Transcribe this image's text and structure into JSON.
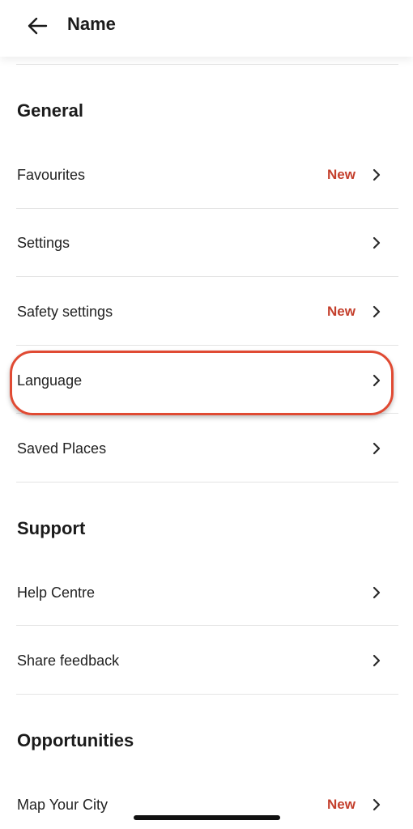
{
  "header": {
    "title": "Name",
    "back_icon": "arrow-left-icon"
  },
  "sections": {
    "general": {
      "title": "General",
      "items": [
        {
          "label": "Favourites",
          "badge": "New"
        },
        {
          "label": "Settings",
          "badge": ""
        },
        {
          "label": "Safety settings",
          "badge": "New"
        },
        {
          "label": "Language",
          "badge": "",
          "highlighted": true
        },
        {
          "label": "Saved Places",
          "badge": ""
        }
      ]
    },
    "support": {
      "title": "Support",
      "items": [
        {
          "label": "Help Centre",
          "badge": ""
        },
        {
          "label": "Share feedback",
          "badge": ""
        }
      ]
    },
    "opportunities": {
      "title": "Opportunities",
      "items": [
        {
          "label": "Map Your City",
          "badge": "New"
        }
      ]
    }
  },
  "colors": {
    "badge": "#c43f2c",
    "highlight_outline": "#e04a33",
    "divider": "#e4e4e4",
    "text": "#1b1b1b"
  },
  "icons": {
    "chevron": "chevron-right-icon"
  }
}
